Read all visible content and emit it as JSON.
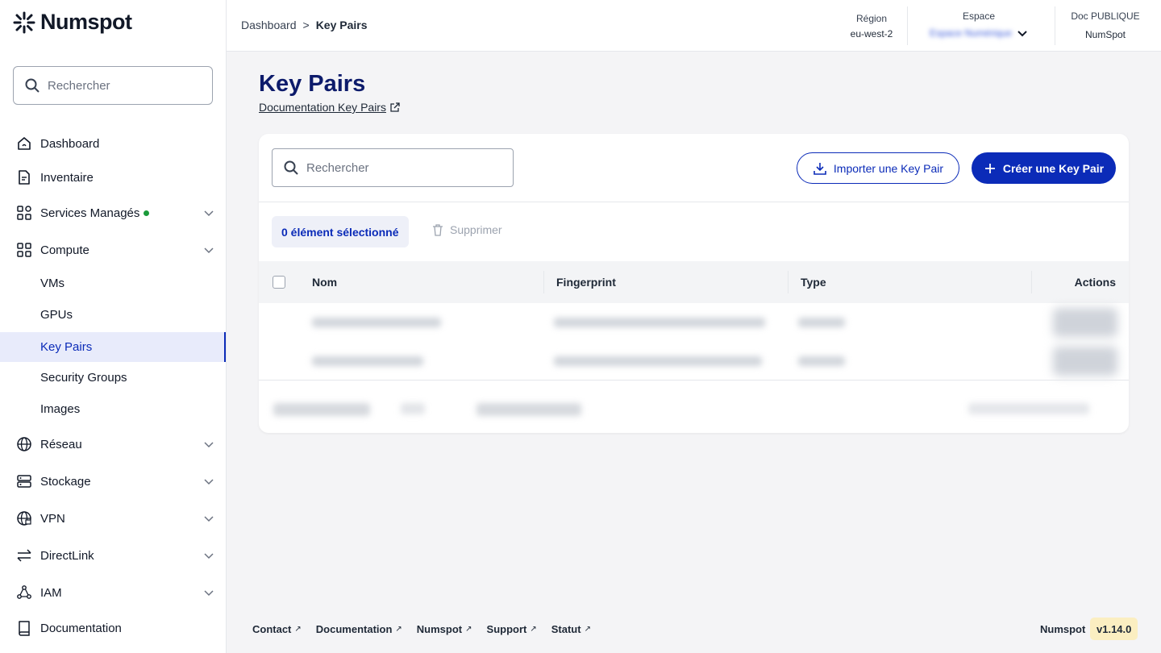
{
  "brand": {
    "name": "Numspot"
  },
  "sidebar": {
    "search_placeholder": "Rechercher",
    "items": {
      "dashboard": "Dashboard",
      "inventaire": "Inventaire",
      "services": "Services Managés",
      "compute": "Compute",
      "vms": "VMs",
      "gpus": "GPUs",
      "keypairs": "Key Pairs",
      "security_groups": "Security Groups",
      "images": "Images",
      "reseau": "Réseau",
      "stockage": "Stockage",
      "vpn": "VPN",
      "directlink": "DirectLink",
      "iam": "IAM",
      "documentation": "Documentation"
    }
  },
  "topbar": {
    "breadcrumb": {
      "parent": "Dashboard",
      "separator": ">",
      "current": "Key Pairs"
    },
    "region": {
      "label": "Région",
      "value": "eu-west-2"
    },
    "espace": {
      "label": "Espace",
      "value": "Espace Numérique"
    },
    "doc": {
      "label": "Doc PUBLIQUE",
      "value": "NumSpot"
    }
  },
  "main": {
    "title": "Key Pairs",
    "doc_link": "Documentation Key Pairs",
    "search_placeholder": "Rechercher",
    "import_button": "Importer une Key Pair",
    "create_button": "Créer une Key Pair",
    "selected_badge": "0 élément sélectionné",
    "delete_button": "Supprimer",
    "table": {
      "columns": {
        "name": "Nom",
        "fingerprint": "Fingerprint",
        "type": "Type",
        "actions": "Actions"
      }
    }
  },
  "footer": {
    "links": [
      "Contact",
      "Documentation",
      "Numspot",
      "Support",
      "Statut"
    ],
    "brand": "Numspot",
    "version": "v1.14.0"
  },
  "colors": {
    "primary": "#0b2bb8",
    "title": "#0d1b6b",
    "active_bg": "#e8ebfb",
    "status_dot": "#1a9a3a",
    "version_bg": "#fbeec1"
  }
}
